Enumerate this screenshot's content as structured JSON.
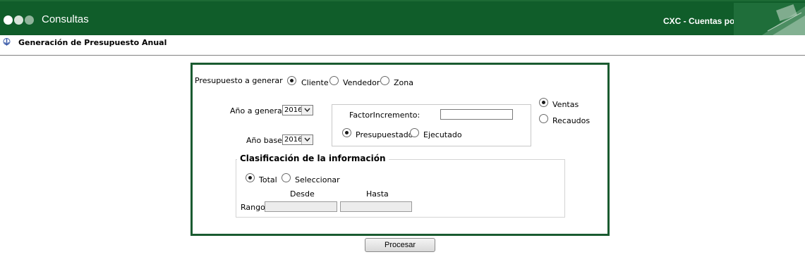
{
  "header": {
    "app_title": "Consultas",
    "module_title": "CXC - Cuentas por Cobrar",
    "bar_color": "#105d2a"
  },
  "page": {
    "title": "Generación de Presupuesto Anual"
  },
  "form": {
    "presupuesto_label": "Presupuesto a generar",
    "presupuesto_options": [
      {
        "label": "Cliente",
        "checked": true
      },
      {
        "label": "Vendedor",
        "checked": false
      },
      {
        "label": "Zona",
        "checked": false
      }
    ],
    "anio_generar_label": "Año a generar:",
    "anio_generar_value": "2016",
    "anio_base_label": "Año base:",
    "anio_base_value": "2016",
    "factor_label": "FactorIncremento:",
    "factor_value": "",
    "base_options": [
      {
        "label": "Presupuestado",
        "checked": true
      },
      {
        "label": "Ejecutado",
        "checked": false
      }
    ],
    "tipo_options": [
      {
        "label": "Ventas",
        "checked": true
      },
      {
        "label": "Recaudos",
        "checked": false
      }
    ],
    "clasificacion_title": "Clasificación de la información",
    "clasificacion_options": [
      {
        "label": "Total",
        "checked": true
      },
      {
        "label": "Seleccionar",
        "checked": false
      }
    ],
    "desde_label": "Desde",
    "hasta_label": "Hasta",
    "rango_label": "Rango",
    "desde_value": "",
    "hasta_value": ""
  },
  "actions": {
    "procesar_label": "Procesar"
  }
}
